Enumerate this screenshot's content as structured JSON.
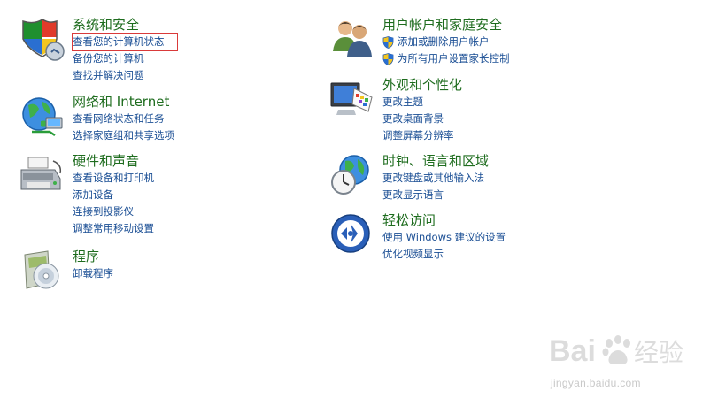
{
  "categories": {
    "system": {
      "title": "系统和安全",
      "links": [
        "查看您的计算机状态",
        "备份您的计算机",
        "查找并解决问题"
      ]
    },
    "network": {
      "title": "网络和 Internet",
      "links": [
        "查看网络状态和任务",
        "选择家庭组和共享选项"
      ]
    },
    "hardware": {
      "title": "硬件和声音",
      "links": [
        "查看设备和打印机",
        "添加设备",
        "连接到投影仪",
        "调整常用移动设置"
      ]
    },
    "programs": {
      "title": "程序",
      "links": [
        "卸载程序"
      ]
    },
    "users": {
      "title": "用户帐户和家庭安全",
      "links": [
        "添加或删除用户帐户",
        "为所有用户设置家长控制"
      ]
    },
    "appearance": {
      "title": "外观和个性化",
      "links": [
        "更改主题",
        "更改桌面背景",
        "调整屏幕分辨率"
      ]
    },
    "clock": {
      "title": "时钟、语言和区域",
      "links": [
        "更改键盘或其他输入法",
        "更改显示语言"
      ]
    },
    "ease": {
      "title": "轻松访问",
      "links": [
        "使用 Windows 建议的设置",
        "优化视频显示"
      ]
    }
  },
  "watermark": {
    "text": "jingyan.baidu.com"
  },
  "colors": {
    "title_green": "#1e6c1e",
    "link_blue": "#1a4e94",
    "highlight_red": "#d93a3a"
  }
}
